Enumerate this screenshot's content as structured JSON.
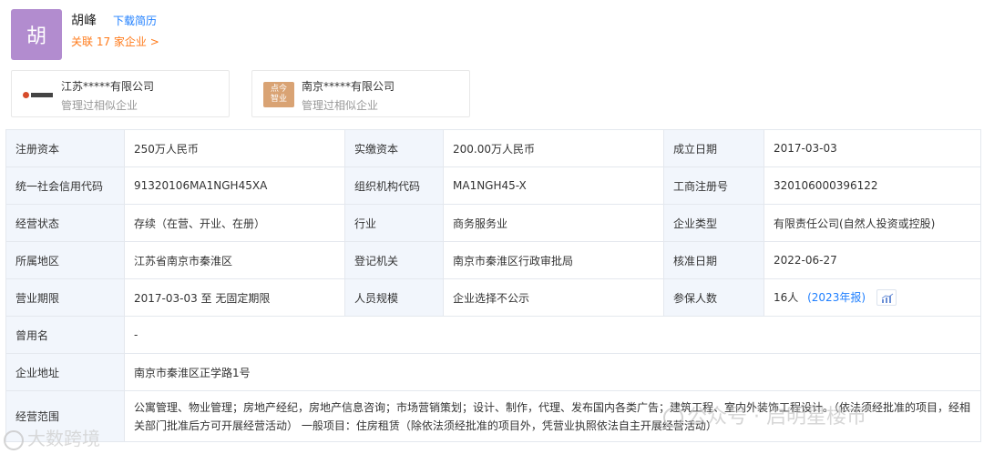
{
  "person": {
    "avatar_char": "胡",
    "name": "胡峰",
    "download_label": "下载简历",
    "related_label": "关联 17 家企业 >"
  },
  "companies": [
    {
      "name": "江苏*****有限公司",
      "sub": "管理过相似企业"
    },
    {
      "name": "南京*****有限公司",
      "sub": "管理过相似企业",
      "logo_text": "点今\n智业"
    }
  ],
  "info": {
    "reg_capital_label": "注册资本",
    "reg_capital": "250万人民币",
    "paid_capital_label": "实缴资本",
    "paid_capital": "200.00万人民币",
    "established_label": "成立日期",
    "established": "2017-03-03",
    "credit_code_label": "统一社会信用代码",
    "credit_code": "91320106MA1NGH45XA",
    "org_code_label": "组织机构代码",
    "org_code": "MA1NGH45-X",
    "reg_no_label": "工商注册号",
    "reg_no": "320106000396122",
    "status_label": "经营状态",
    "status": "存续（在营、开业、在册）",
    "industry_label": "行业",
    "industry": "商务服务业",
    "type_label": "企业类型",
    "type": "有限责任公司(自然人投资或控股)",
    "region_label": "所属地区",
    "region": "江苏省南京市秦淮区",
    "authority_label": "登记机关",
    "authority": "南京市秦淮区行政审批局",
    "approved_label": "核准日期",
    "approved": "2022-06-27",
    "term_label": "营业期限",
    "term": "2017-03-03 至 无固定期限",
    "staff_label": "人员规模",
    "staff": "企业选择不公示",
    "insured_label": "参保人数",
    "insured": "16人",
    "insured_report": "(2023年报)",
    "former_name_label": "曾用名",
    "former_name": "-",
    "address_label": "企业地址",
    "address": "南京市秦淮区正学路1号",
    "scope_label": "经营范围",
    "scope": "公寓管理、物业管理；房地产经纪，房地产信息咨询；市场营销策划；设计、制作，代理、发布国内各类广告；建筑工程、室内外装饰工程设计。（依法须经批准的项目，经相关部门批准后方可开展经营活动） 一般项目：住房租赁（除依法须经批准的项目外，凭营业执照依法自主开展经营活动）"
  },
  "watermark": {
    "left": "大数跨境",
    "right": "公众号 · 启明星楼市"
  }
}
